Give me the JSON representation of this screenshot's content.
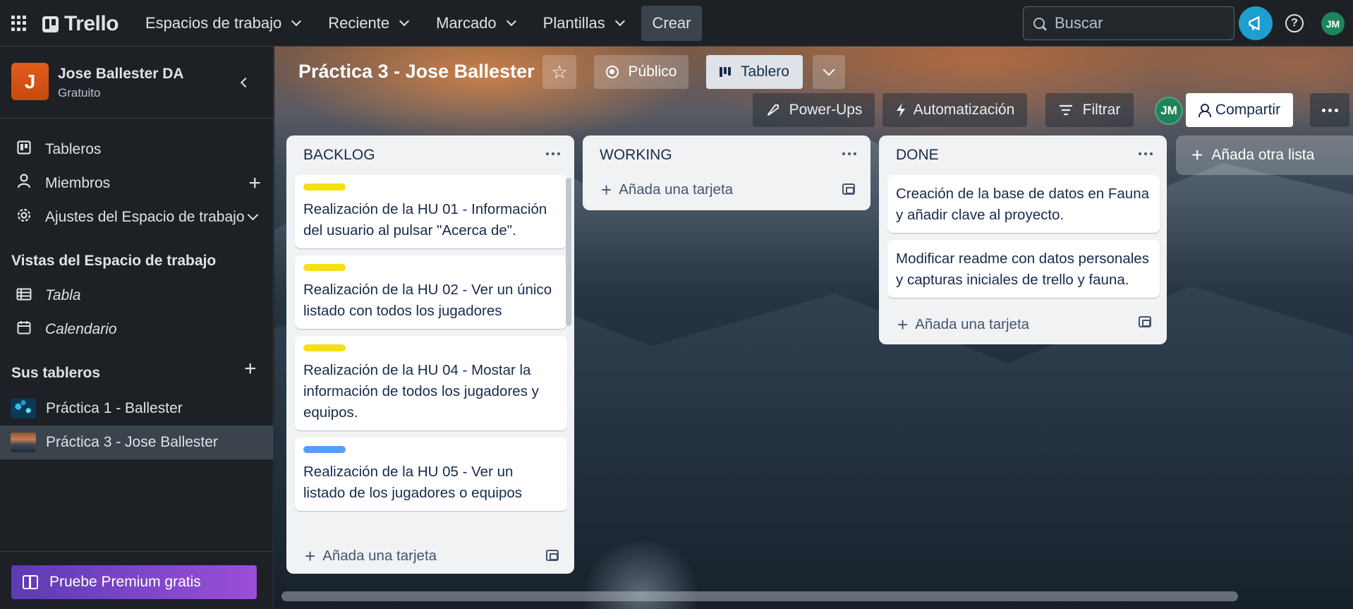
{
  "topbar": {
    "app_name": "Trello",
    "menu": [
      {
        "label": "Espacios de trabajo"
      },
      {
        "label": "Reciente"
      },
      {
        "label": "Marcado"
      },
      {
        "label": "Plantillas"
      }
    ],
    "create_label": "Crear",
    "search_placeholder": "Buscar",
    "help_glyph": "?",
    "avatar_initials": "JM"
  },
  "sidebar": {
    "workspace": {
      "initial": "J",
      "name": "Jose Ballester DA",
      "plan": "Gratuito"
    },
    "items": [
      {
        "label": "Tableros",
        "icon": "board-icon"
      },
      {
        "label": "Miembros",
        "icon": "person-icon"
      },
      {
        "label": "Ajustes del Espacio de trabajo",
        "icon": "gear-icon"
      }
    ],
    "views_title": "Vistas del Espacio de trabajo",
    "views": [
      {
        "label": "Tabla",
        "icon": "table-icon"
      },
      {
        "label": "Calendario",
        "icon": "calendar-icon"
      }
    ],
    "boards_title": "Sus tableros",
    "boards": [
      {
        "label": "Práctica 1 - Ballester"
      },
      {
        "label": "Práctica 3 - Jose Ballester"
      }
    ],
    "premium_label": "Pruebe Premium gratis"
  },
  "board": {
    "title": "Práctica 3 - Jose Ballester",
    "visibility_label": "Público",
    "view_label": "Tablero",
    "powerups_label": "Power-Ups",
    "automation_label": "Automatización",
    "filter_label": "Filtrar",
    "member_initials": "JM",
    "share_label": "Compartir",
    "add_list_label": "Añada otra lista"
  },
  "lists": [
    {
      "title": "BACKLOG",
      "add_card_label": "Añada una tarjeta",
      "cards": [
        {
          "label_color": "#f5e014",
          "text": "Realización de la HU 01 - Información del usuario al pulsar \"Acerca de\"."
        },
        {
          "label_color": "#f5e014",
          "text": "Realización de la HU 02 - Ver un único listado con todos los jugadores"
        },
        {
          "label_color": "#f5e014",
          "text": "Realización de la HU 04 - Mostar la información de todos los jugadores y equipos."
        },
        {
          "label_color": "#579dff",
          "text": "Realización de la HU 05 - Ver un listado de los jugadores o equipos"
        }
      ]
    },
    {
      "title": "WORKING",
      "add_card_label": "Añada una tarjeta",
      "cards": []
    },
    {
      "title": "DONE",
      "add_card_label": "Añada una tarjeta",
      "cards": [
        {
          "text": "Creación de la base de datos en Fauna y añadir clave al proyecto."
        },
        {
          "text": "Modificar readme con datos personales y capturas iniciales de trello y fauna."
        }
      ]
    }
  ],
  "colors": {
    "accent_blue": "#1d9fcf",
    "workspace_orange": "#e25d1c",
    "premium_gradient_start": "#5b3bb4",
    "premium_gradient_end": "#9b4fd9",
    "avatar_green": "#1f845a"
  }
}
